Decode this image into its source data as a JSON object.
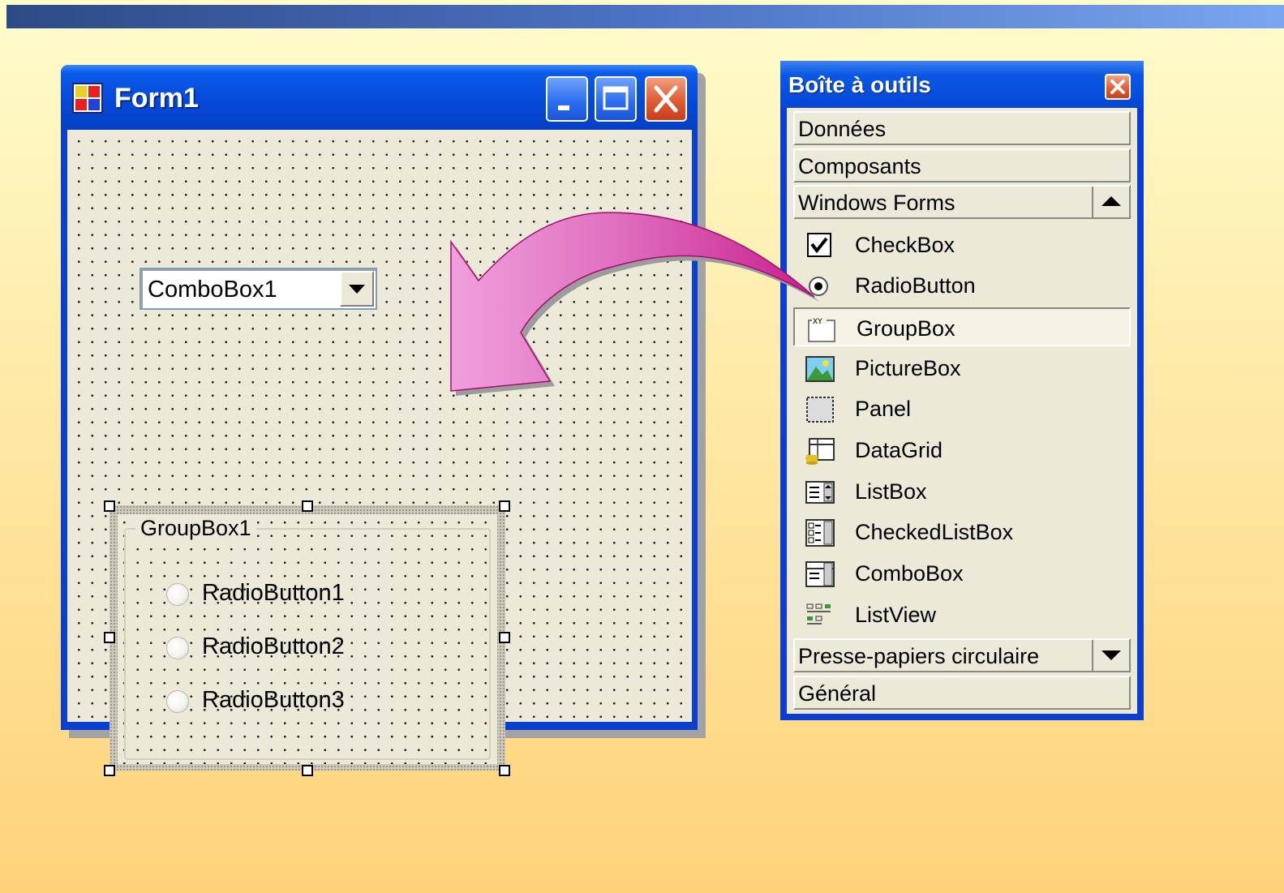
{
  "form_window": {
    "title": "Form1",
    "combobox_value": "ComboBox1",
    "groupbox_label": "GroupBox1",
    "radio_buttons": [
      "RadioButton1",
      "RadioButton2",
      "RadioButton3"
    ]
  },
  "toolbox": {
    "title": "Boîte à outils",
    "categories_top": [
      "Données",
      "Composants"
    ],
    "active_category": "Windows Forms",
    "tools": [
      {
        "label": "CheckBox",
        "icon": "checkbox-icon"
      },
      {
        "label": "RadioButton",
        "icon": "radiobutton-icon"
      },
      {
        "label": "GroupBox",
        "icon": "groupbox-icon",
        "selected": true
      },
      {
        "label": "PictureBox",
        "icon": "picturebox-icon"
      },
      {
        "label": "Panel",
        "icon": "panel-icon"
      },
      {
        "label": "DataGrid",
        "icon": "datagrid-icon"
      },
      {
        "label": "ListBox",
        "icon": "listbox-icon"
      },
      {
        "label": "CheckedListBox",
        "icon": "checkedlistbox-icon"
      },
      {
        "label": "ComboBox",
        "icon": "combobox-icon"
      },
      {
        "label": "ListView",
        "icon": "listview-icon"
      }
    ],
    "categories_bottom": [
      "Presse-papiers circulaire",
      "Général"
    ]
  },
  "colors": {
    "titlebar_blue": "#0a58e4",
    "form_background": "#ece9d8",
    "arrow_pink": "#e070c0",
    "close_red": "#e05a32"
  }
}
